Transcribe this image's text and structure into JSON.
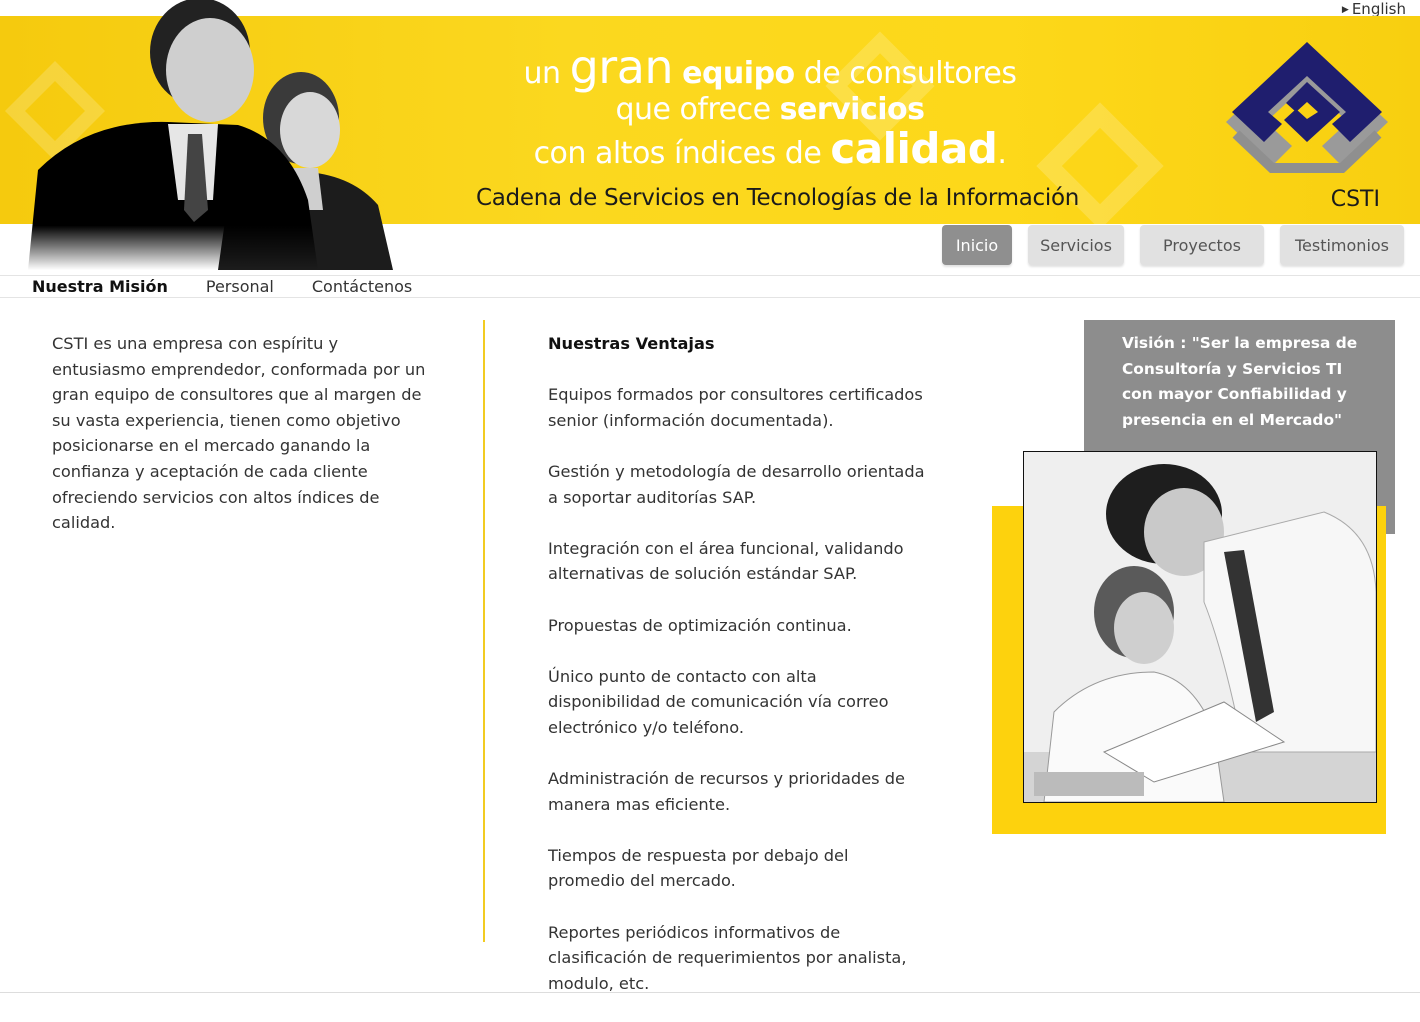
{
  "language_link": "English",
  "header": {
    "headline": {
      "line1_pre": "un",
      "line1_big": "gran",
      "line1_bold": "equipo",
      "line1_post": "de consultores",
      "line2_pre": "que ofrece",
      "line2_bold": "servicios",
      "line3_pre": "con altos índices de",
      "line3_big": "calidad",
      "line3_post": "."
    },
    "tagline": "Cadena de Servicios en Tecnologías de la Información",
    "brand": "CSTI"
  },
  "tabs": [
    {
      "label": "Inicio",
      "active": true
    },
    {
      "label": "Servicios",
      "active": false
    },
    {
      "label": "Proyectos",
      "active": false
    },
    {
      "label": "Testimonios",
      "active": false
    }
  ],
  "subnav": [
    {
      "label": "Nuestra Misión",
      "active": true
    },
    {
      "label": "Personal",
      "active": false
    },
    {
      "label": "Contáctenos",
      "active": false
    }
  ],
  "mission_text": "CSTI es una empresa con espíritu y entusiasmo emprendedor, conformada por un gran equipo de consultores que al margen de su vasta experiencia, tienen como objetivo posicionarse en el mercado ganando la confianza y aceptación de cada cliente ofreciendo servicios con altos índices de calidad.",
  "advantages": {
    "title": "Nuestras Ventajas",
    "items": [
      " Equipos formados por consultores certificados senior (información documentada).",
      " Gestión  y metodología de desarrollo orientada a soportar auditorías SAP.",
      " Integración con el área funcional, validando alternativas de solución estándar SAP.",
      " Propuestas de optimización continua.",
      " Único punto de contacto con alta disponibilidad de comunicación vía correo electrónico y/o teléfono.",
      "Administración de recursos y prioridades de manera mas eficiente.",
      " Tiempos de respuesta por debajo del promedio del mercado.",
      " Reportes periódicos informativos de clasificación de requerimientos por analista, modulo, etc."
    ]
  },
  "vision": {
    "label": "Visión",
    "text": " : \"Ser la empresa de Consultoría y Servicios TI con mayor Confiabilidad y presencia en el Mercado\""
  },
  "colors": {
    "brand_yellow": "#fdd20d",
    "tab_active": "#8f8f8f",
    "tab_inactive": "#e1e1e1",
    "vision_gray": "#8d8d8d"
  }
}
